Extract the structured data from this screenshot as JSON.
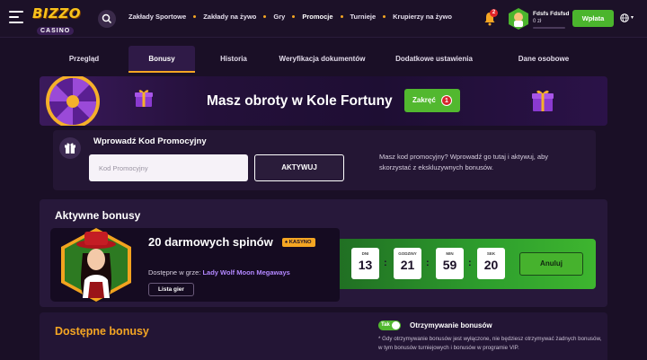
{
  "header": {
    "logo_top": "BIZZO",
    "logo_bottom": "CASINO",
    "nav": [
      "Zakłady Sportowe",
      "Zakłady na żywo",
      "Gry",
      "Promocje",
      "Turnieje",
      "Krupierzy na żywo"
    ],
    "notifications_count": "2",
    "user_name": "Fdsfs Fdsfsd",
    "user_balance": "0 zł",
    "deposit_label": "Wpłata"
  },
  "tabs": [
    "Przegląd",
    "Bonusy",
    "Historia",
    "Weryfikacja dokumentów",
    "Dodatkowe ustawienia",
    "Dane osobowe"
  ],
  "active_tab": "Bonusy",
  "wheel_banner": {
    "title": "Masz obroty w Kole Fortuny",
    "spin_label": "Zakręć",
    "spin_count": "1"
  },
  "promo": {
    "title": "Wprowadź Kod Promocyjny",
    "placeholder": "Kod Promocyjny",
    "activate_label": "AKTYWUJ",
    "description": "Masz kod promocyjny? Wprowadź go tutaj i aktywuj, aby skorzystać z ekskluzywnych bonusów."
  },
  "active_bonuses": {
    "title": "Aktywne bonusy",
    "bonus_name": "20 darmowych spinów",
    "badge": "KASYNO",
    "available_in_label": "Dostępne w grze:",
    "game_name": "Lady Wolf Moon Megaways",
    "game_list_label": "Lista gier",
    "timer": [
      {
        "label": "DNI",
        "value": "13"
      },
      {
        "label": "GODZINY",
        "value": "21"
      },
      {
        "label": "MIN",
        "value": "59"
      },
      {
        "label": "SEK",
        "value": "20"
      }
    ],
    "cancel_label": "Anuluj"
  },
  "available_bonuses": {
    "title": "Dostępne bonusy",
    "toggle_label": "Tak",
    "receive_label": "Otrzymywanie bonusów",
    "note": "* Gdy otrzymywanie bonusów jest wyłączone, nie będziesz otrzymywać żadnych bonusów, w tym bonusów turniejowych i bonusów w programie VIP."
  },
  "colors": {
    "accent_orange": "#f5a623",
    "accent_green": "#4bb52d",
    "background": "#1a0f26"
  }
}
